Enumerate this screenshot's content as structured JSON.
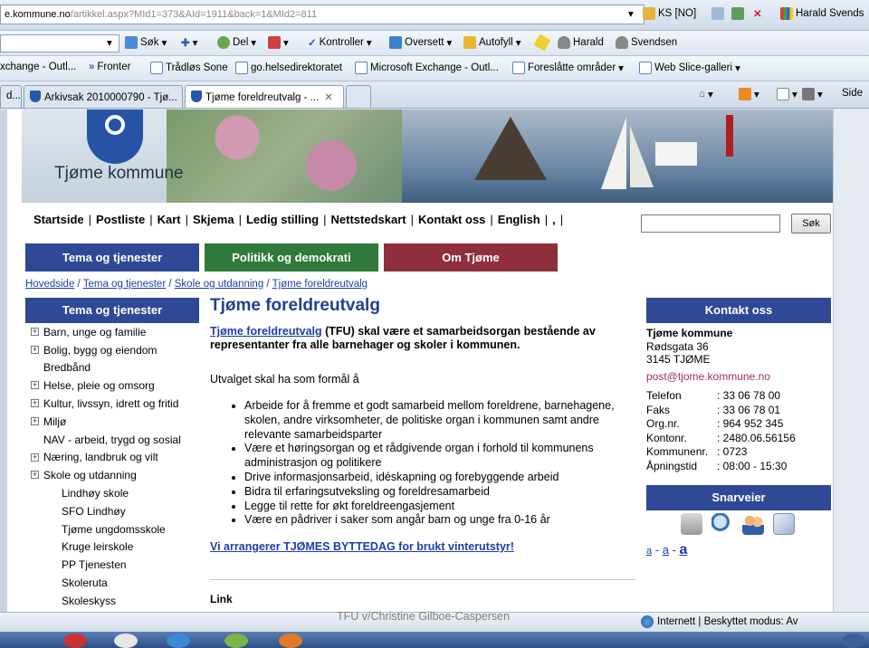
{
  "browser": {
    "address_host": "e.kommune.no",
    "address_path": "/artikkel.aspx?MId1=373&AId=1911&back=1&MId2=811",
    "security_label": "KS [NO]",
    "user_tab": "Harald Svends",
    "toolbar": {
      "search": "Søk",
      "share": "Del",
      "check": "Kontroller",
      "translate": "Oversett",
      "autofill": "Autofyll",
      "user1": "Harald",
      "user2": "Svendsen"
    },
    "favorites": [
      "xchange - Outl...",
      "Fronter",
      "Trådløs Sone",
      "go.helsedirektoratet",
      "Microsoft Exchange - Outl...",
      "Foreslåtte områder",
      "Web Slice-galleri"
    ],
    "tabs": [
      "d...",
      "Arkivsak 2010000790 - Tjø...",
      "Tjøme foreldreutvalg - ..."
    ],
    "tab_right_label": "Side",
    "status_zone": "Internett | Beskyttet modus: Av"
  },
  "site": {
    "brand": "Tjøme kommune",
    "topnav": [
      "Startside",
      "Postliste",
      "Kart",
      "Skjema",
      "Ledig stilling",
      "Nettstedskart",
      "Kontakt oss",
      "English",
      ","
    ],
    "search_button": "Søk",
    "main_tabs": [
      "Tema og tjenester",
      "Politikk og demokrati",
      "Om Tjøme"
    ],
    "breadcrumb": [
      "Hovedside",
      "Tema og tjenester",
      "Skole og utdanning",
      "Tjøme foreldreutvalg"
    ]
  },
  "left_menu": {
    "heading": "Tema og tjenester",
    "items": [
      {
        "label": "Barn, unge og familie",
        "expandable": true,
        "sub": false
      },
      {
        "label": "Bolig, bygg og eiendom",
        "expandable": true,
        "sub": false
      },
      {
        "label": "Bredbånd",
        "expandable": false,
        "sub": false
      },
      {
        "label": "Helse, pleie og omsorg",
        "expandable": true,
        "sub": false
      },
      {
        "label": "Kultur, livssyn, idrett og fritid",
        "expandable": true,
        "sub": false
      },
      {
        "label": "Miljø",
        "expandable": true,
        "sub": false
      },
      {
        "label": "NAV - arbeid, trygd og sosial",
        "expandable": false,
        "sub": false
      },
      {
        "label": "Næring, landbruk og vilt",
        "expandable": true,
        "sub": false
      },
      {
        "label": "Skole og utdanning",
        "expandable": true,
        "sub": false
      },
      {
        "label": "Lindhøy skole",
        "expandable": false,
        "sub": true
      },
      {
        "label": "SFO Lindhøy",
        "expandable": false,
        "sub": true
      },
      {
        "label": "Tjøme ungdomsskole",
        "expandable": false,
        "sub": true
      },
      {
        "label": "Kruge leirskole",
        "expandable": false,
        "sub": true
      },
      {
        "label": "PP Tjenesten",
        "expandable": false,
        "sub": true
      },
      {
        "label": "Skoleruta",
        "expandable": false,
        "sub": true
      },
      {
        "label": "Skoleskyss",
        "expandable": false,
        "sub": true
      }
    ]
  },
  "article": {
    "title": "Tjøme foreldreutvalg",
    "intro_link": "Tjøme foreldreutvalg",
    "intro_rest": " (TFU) skal være et samarbeidsorgan bestående av representanter fra alle barnehager og skoler i kommunen.",
    "purpose": "Utvalget skal ha som formål å",
    "bullets": [
      "Arbeide for å fremme et godt samarbeid mellom foreldrene, barnehagene, skolen, andre virksomheter, de politiske organ i kommunen samt andre relevante samarbeidsparter",
      "Være et høringsorgan og et rådgivende organ i forhold til kommunens administrasjon og politikere",
      "Drive informasjonsarbeid, idéskapning og forebyggende arbeid",
      "Bidra til erfaringsutveksling og foreldresamarbeid",
      "Legge til rette for økt foreldreengasjement",
      "Være en pådriver i saker som angår barn og unge fra 0-16 år"
    ],
    "cta": "Vi arrangerer TJØMES BYTTEDAG for brukt vinterutstyr!",
    "links_heading": "Link"
  },
  "contact": {
    "heading": "Kontakt oss",
    "name": "Tjøme kommune",
    "street": "Rødsgata 36",
    "postal": "3145  TJØME",
    "email": "post@tjome.kommune.no",
    "facts": [
      {
        "label": "Telefon",
        "value": ": 33 06 78 00"
      },
      {
        "label": "Faks",
        "value": ": 33 06 78 01"
      },
      {
        "label": "Org.nr.",
        "value": ": 964 952 345"
      },
      {
        "label": "Kontonr.",
        "value": ": 2480.06.56156"
      },
      {
        "label": "Kommunenr.",
        "value": ": 0723"
      },
      {
        "label": "Åpningstid",
        "value": ": 08:00 - 15:30"
      }
    ]
  },
  "shortcuts": {
    "heading": "Snarveier",
    "font_small": "a",
    "font_medium": "a",
    "font_large": "a",
    "sep": " - "
  },
  "overlay_credit": "TFU v/Christine Gilboe-Caspersen",
  "colors": {
    "nav_blue": "#2f4996",
    "nav_green": "#2f7a3a",
    "nav_red": "#8e2f3b",
    "link": "#1d3fa6",
    "title": "#233f8e"
  }
}
